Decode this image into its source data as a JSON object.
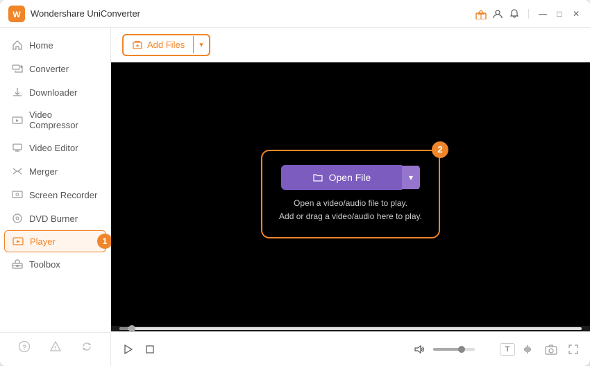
{
  "app": {
    "title": "Wondershare UniConverter",
    "logo_color": "#f0852a"
  },
  "titlebar": {
    "title": "Wondershare UniConverter",
    "gift_label": "gift",
    "user_label": "user",
    "bell_label": "bell",
    "minimize_label": "—",
    "maximize_label": "□",
    "close_label": "✕"
  },
  "sidebar": {
    "items": [
      {
        "id": "home",
        "label": "Home",
        "icon": "home"
      },
      {
        "id": "converter",
        "label": "Converter",
        "icon": "converter"
      },
      {
        "id": "downloader",
        "label": "Downloader",
        "icon": "downloader"
      },
      {
        "id": "video-compressor",
        "label": "Video Compressor",
        "icon": "compress"
      },
      {
        "id": "video-editor",
        "label": "Video Editor",
        "icon": "edit"
      },
      {
        "id": "merger",
        "label": "Merger",
        "icon": "merge"
      },
      {
        "id": "screen-recorder",
        "label": "Screen Recorder",
        "icon": "record"
      },
      {
        "id": "dvd-burner",
        "label": "DVD Burner",
        "icon": "dvd"
      },
      {
        "id": "player",
        "label": "Player",
        "icon": "player",
        "active": true
      },
      {
        "id": "toolbox",
        "label": "Toolbox",
        "icon": "toolbox"
      }
    ],
    "bottom_icons": [
      "help",
      "bell",
      "refresh"
    ]
  },
  "toolbar": {
    "add_button_label": "Add Files",
    "add_button_arrow": "▾"
  },
  "player": {
    "open_file_label": "Open File",
    "open_file_arrow": "▾",
    "hint_line1": "Open a video/audio file to play.",
    "hint_line2": "Add or drag a video/audio here to play.",
    "badge1_number": "1",
    "badge2_number": "2"
  },
  "controls": {
    "play": "▶",
    "stop": "■",
    "volume": "🔊",
    "captions": "T",
    "audio_tracks": "♫",
    "snapshot": "⊡",
    "fullscreen": "⛶"
  }
}
